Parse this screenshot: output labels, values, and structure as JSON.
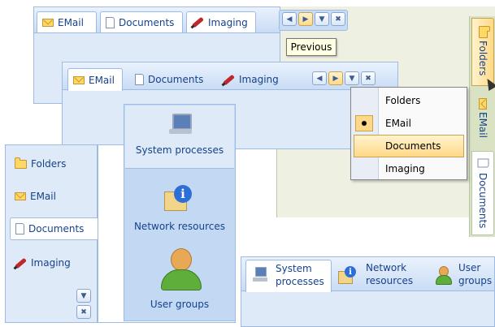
{
  "top_window": {
    "tabs": [
      {
        "label": "EMail",
        "icon": "envelope-icon"
      },
      {
        "label": "Documents",
        "icon": "document-icon"
      },
      {
        "label": "Imaging",
        "icon": "pen-icon"
      }
    ],
    "tooltip": "Previous"
  },
  "middle_window": {
    "tabs": [
      {
        "label": "EMail",
        "icon": "envelope-icon"
      },
      {
        "label": "Documents",
        "icon": "document-icon"
      },
      {
        "label": "Imaging",
        "icon": "pen-icon"
      }
    ]
  },
  "popup_menu": {
    "items": [
      {
        "label": "Folders",
        "checked": false
      },
      {
        "label": "EMail",
        "checked": true
      },
      {
        "label": "Documents",
        "checked": false,
        "highlighted": true
      },
      {
        "label": "Imaging",
        "checked": false
      }
    ]
  },
  "right_vertical_tabs": [
    {
      "label": "Folders",
      "icon": "folder-icon"
    },
    {
      "label": "EMail",
      "icon": "envelope-icon"
    },
    {
      "label": "Documents",
      "icon": "document-icon"
    }
  ],
  "left_vertical_list": {
    "items": [
      {
        "label": "Folders",
        "icon": "folder-icon"
      },
      {
        "label": "EMail",
        "icon": "envelope-icon"
      },
      {
        "label": "Documents",
        "icon": "document-icon"
      },
      {
        "label": "Imaging",
        "icon": "pen-icon"
      }
    ]
  },
  "big_icon_panel": {
    "items": [
      {
        "label": "System processes",
        "icon": "computer-icon"
      },
      {
        "label": "Network resources",
        "icon": "network-info-icon"
      },
      {
        "label": "User groups",
        "icon": "user-icon"
      }
    ]
  },
  "bottom_window": {
    "tabs": [
      {
        "line1": "System",
        "line2": "processes",
        "icon": "computer-icon"
      },
      {
        "line1": "Network",
        "line2": "resources",
        "icon": "network-info-icon"
      },
      {
        "line1": "User",
        "line2": "groups",
        "icon": "user-icon"
      }
    ]
  },
  "colors": {
    "panel": "#dfeaf8",
    "border": "#9ebbe3",
    "highlight": "#ffd987",
    "text": "#15428b"
  }
}
